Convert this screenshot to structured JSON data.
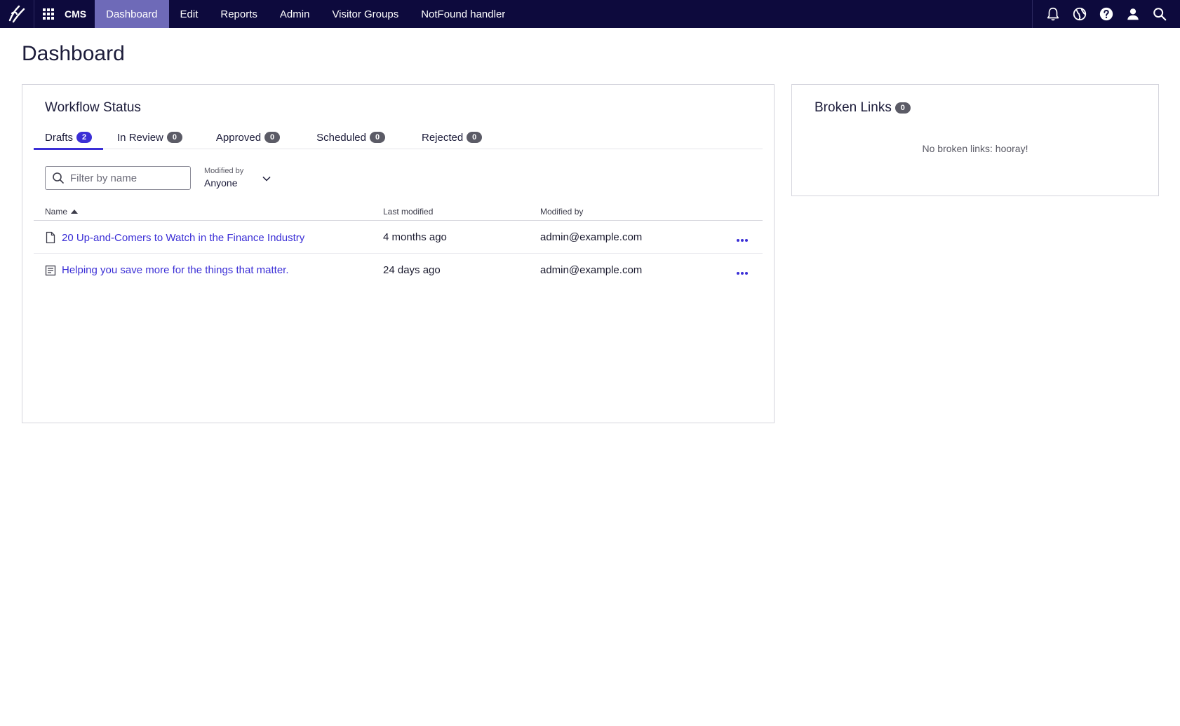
{
  "topbar": {
    "product": "CMS",
    "nav": [
      "Dashboard",
      "Edit",
      "Reports",
      "Admin",
      "Visitor Groups",
      "NotFound handler"
    ],
    "active": "Dashboard",
    "icons": [
      "bell-icon",
      "globe-icon",
      "help-icon",
      "user-icon",
      "search-icon"
    ]
  },
  "page": {
    "title": "Dashboard"
  },
  "workflow": {
    "title": "Workflow Status",
    "tabs": [
      {
        "label": "Drafts",
        "count": "2"
      },
      {
        "label": "In Review",
        "count": "0"
      },
      {
        "label": "Approved",
        "count": "0"
      },
      {
        "label": "Scheduled",
        "count": "0"
      },
      {
        "label": "Rejected",
        "count": "0"
      }
    ],
    "filter": {
      "placeholder": "Filter by name",
      "value": ""
    },
    "modified_by": {
      "label": "Modified by",
      "value": "Anyone"
    },
    "columns": {
      "name": "Name",
      "last_modified": "Last modified",
      "modified_by": "Modified by"
    },
    "rows": [
      {
        "name": "20 Up-and-Comers to Watch in the Finance Industry",
        "last_modified": "4 months ago",
        "modified_by": "admin@example.com",
        "icon": "page-icon"
      },
      {
        "name": "Helping you save more for the things that matter.",
        "last_modified": "24 days ago",
        "modified_by": "admin@example.com",
        "icon": "block-icon"
      }
    ]
  },
  "broken_links": {
    "title": "Broken Links",
    "count": "0",
    "empty_message": "No broken links: hooray!"
  },
  "colors": {
    "topbar": "#0d0a3d",
    "active_nav": "#6e6ab8",
    "accent": "#3b2fd6"
  }
}
